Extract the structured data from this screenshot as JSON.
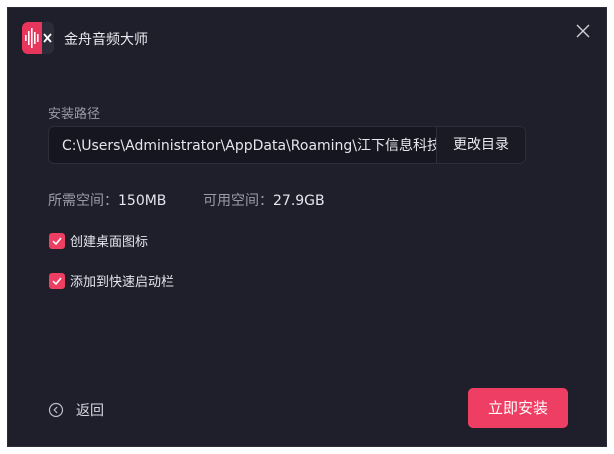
{
  "window": {
    "title": "金舟音频大师"
  },
  "install": {
    "path_label": "安装路径",
    "path_value": "C:\\Users\\Administrator\\AppData\\Roaming\\江下信息科技",
    "change_dir_label": "更改目录"
  },
  "space": {
    "required_label": "所需空间：",
    "required_value": "150MB",
    "available_label": "可用空间：",
    "available_value": "27.9GB"
  },
  "options": {
    "desktop_icon_label": "创建桌面图标",
    "desktop_icon_checked": true,
    "quick_launch_label": "添加到快速启动栏",
    "quick_launch_checked": true
  },
  "footer": {
    "back_label": "返回",
    "install_label": "立即安装"
  },
  "colors": {
    "accent": "#ef3e63",
    "background": "#1f1f2b"
  }
}
